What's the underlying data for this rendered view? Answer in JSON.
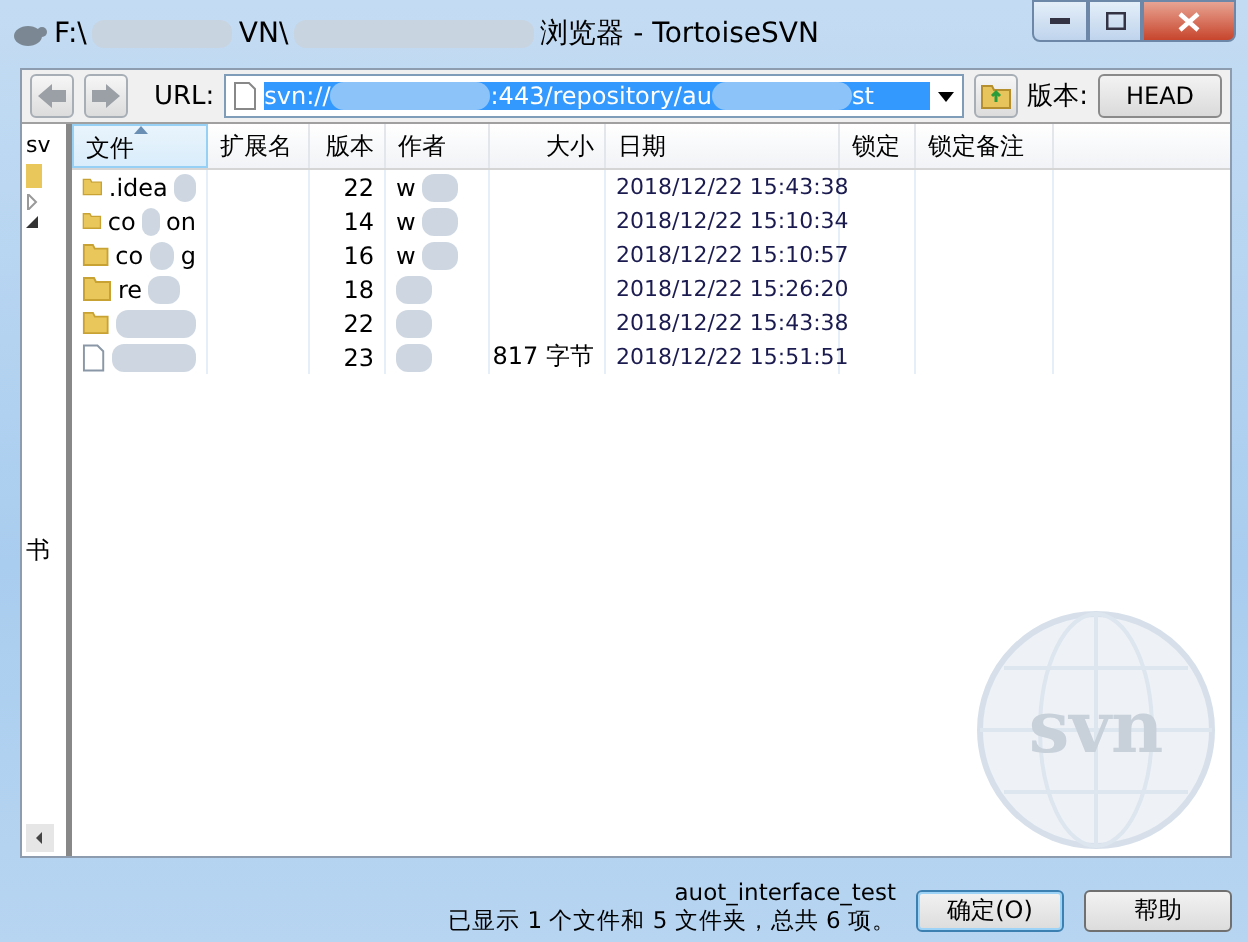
{
  "window": {
    "title_parts": [
      "F:\\",
      "VN\\",
      "浏览器 - TortoiseSVN"
    ]
  },
  "toolbar": {
    "url_label": "URL:",
    "url_parts": [
      "svn://",
      ":443/repository/au",
      "st"
    ],
    "url_selected": true,
    "revision_label": "版本:",
    "revision_button": "HEAD"
  },
  "tree": {
    "root_label": "sv",
    "lower_label": "书"
  },
  "table": {
    "columns": [
      {
        "label": "文件",
        "sorted": true
      },
      {
        "label": "扩展名",
        "sorted": false
      },
      {
        "label": "版本",
        "sorted": false
      },
      {
        "label": "作者",
        "sorted": false
      },
      {
        "label": "大小",
        "sorted": false
      },
      {
        "label": "日期",
        "sorted": false
      },
      {
        "label": "锁定",
        "sorted": false
      },
      {
        "label": "锁定备注",
        "sorted": false
      }
    ],
    "rows": [
      {
        "kind": "folder",
        "name_parts": [
          ".idea"
        ],
        "revision": "22",
        "author": "w",
        "date": "2018/12/22 15:43:38"
      },
      {
        "kind": "folder",
        "name_parts": [
          "co",
          "on"
        ],
        "revision": "14",
        "author": "w",
        "date": "2018/12/22 15:10:34"
      },
      {
        "kind": "folder",
        "name_parts": [
          "co",
          "g"
        ],
        "revision": "16",
        "author": "w",
        "date": "2018/12/22 15:10:57"
      },
      {
        "kind": "folder",
        "name_parts": [
          "re"
        ],
        "revision": "18",
        "date": "2018/12/22 15:26:20"
      },
      {
        "kind": "folder",
        "name_parts": [],
        "revision": "22",
        "date": "2018/12/22 15:43:38"
      },
      {
        "kind": "file",
        "name_parts": [],
        "revision": "23",
        "size": "817 字节",
        "date": "2018/12/22 15:51:51"
      }
    ]
  },
  "logo_text": "svn",
  "footer": {
    "path": "auot_interface_test",
    "status": "已显示 1 个文件和 5 文件夹，总共 6 项。",
    "buttons": [
      {
        "label": "确定(O)",
        "default": true
      },
      {
        "label": "帮助",
        "default": false
      }
    ]
  }
}
